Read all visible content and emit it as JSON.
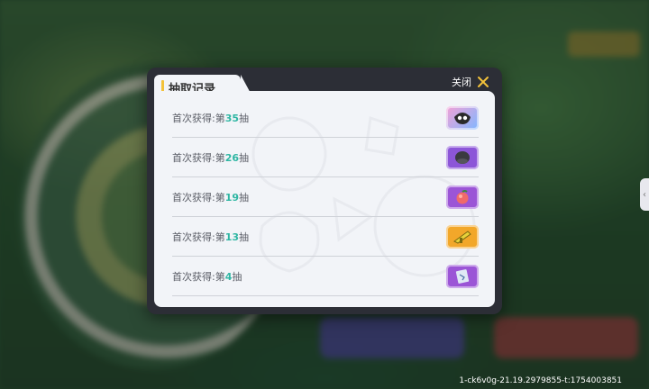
{
  "dialog": {
    "title": "抽取记录",
    "close_label": "关闭"
  },
  "records": [
    {
      "prefix": "首次获得:第",
      "number": "35",
      "suffix": "抽",
      "icon": "owl-mask-icon",
      "color": "#a78af0"
    },
    {
      "prefix": "首次获得:第",
      "number": "26",
      "suffix": "抽",
      "icon": "dark-hat-icon",
      "color": "#8c56d8"
    },
    {
      "prefix": "首次获得:第",
      "number": "19",
      "suffix": "抽",
      "icon": "peach-fruit-icon",
      "color": "#9b55d6"
    },
    {
      "prefix": "首次获得:第",
      "number": "13",
      "suffix": "抽",
      "icon": "golden-gun-icon",
      "color": "#f2a72a"
    },
    {
      "prefix": "首次获得:第",
      "number": "4",
      "suffix": "抽",
      "icon": "map-card-icon",
      "color": "#9b55d6"
    }
  ],
  "footer": {
    "build_id": "1-ck6v0g-21.19.2979855-t:1754003851"
  },
  "colors": {
    "accent_number": "#2fb6a3",
    "title_bar": "#f3c23a",
    "close_x": "#f3c23a"
  }
}
